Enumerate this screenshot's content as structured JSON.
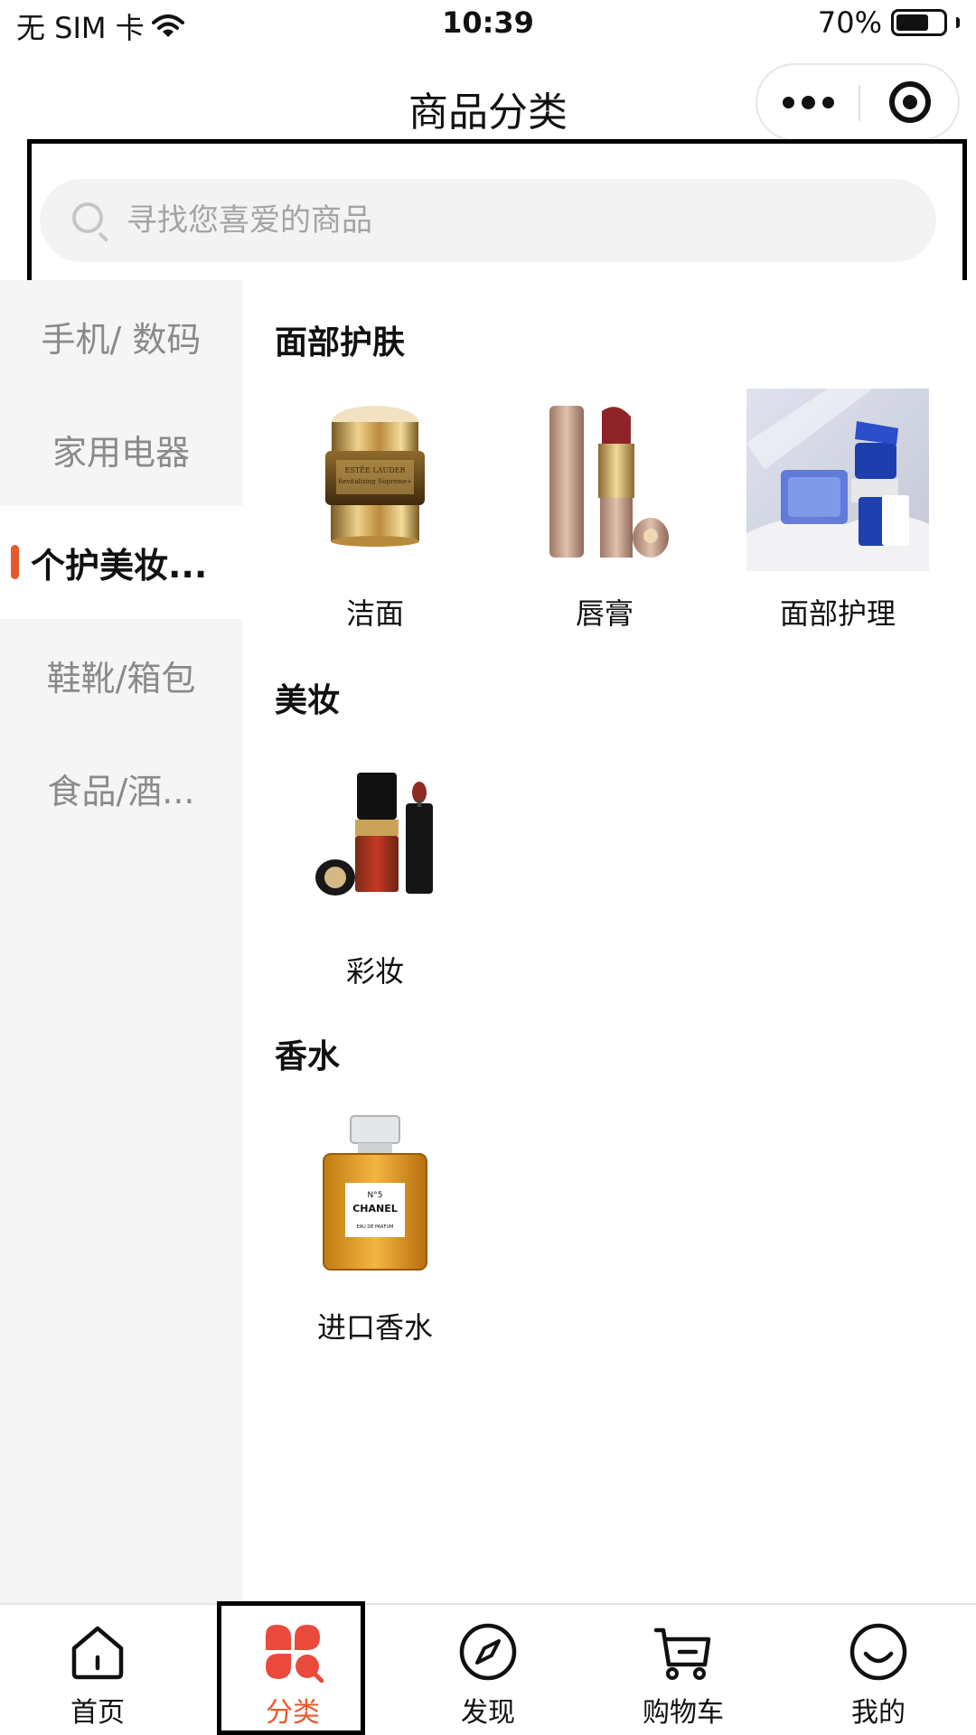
{
  "status_bar": {
    "carrier": "无 SIM 卡",
    "time": "10:39",
    "battery": "70%",
    "battery_level": 0.7
  },
  "nav": {
    "title": "商品分类",
    "more_icon": "more-dots-icon",
    "close_icon": "target-circle-icon"
  },
  "search": {
    "placeholder": "寻找您喜爱的商品",
    "value": ""
  },
  "sidebar": {
    "items": [
      {
        "label": "手机/ 数码",
        "active": false
      },
      {
        "label": "家用电器",
        "active": false
      },
      {
        "label": "个护美妆...",
        "active": true
      },
      {
        "label": "鞋靴/箱包",
        "active": false
      },
      {
        "label": "食品/酒...",
        "active": false
      }
    ],
    "accent": "#e8582a"
  },
  "sections": [
    {
      "title": "面部护肤",
      "items": [
        {
          "label": "洁面",
          "image": "cream-jar"
        },
        {
          "label": "唇膏",
          "image": "lipstick"
        },
        {
          "label": "面部护理",
          "image": "blue-skincare-set"
        }
      ]
    },
    {
      "title": "美妆",
      "items": [
        {
          "label": "彩妆",
          "image": "lip-gloss"
        }
      ]
    },
    {
      "title": "香水",
      "items": [
        {
          "label": "进口香水",
          "image": "perfume-bottle"
        }
      ]
    }
  ],
  "product_art": {
    "cream_brand": "ESTĒE LAUDER",
    "cream_line": "Revitalizing Supreme+",
    "perfume_brand": "CHANEL",
    "perfume_no": "N°5",
    "perfume_type": "EAU DE PARFUM"
  },
  "tabbar": {
    "items": [
      {
        "label": "首页",
        "icon": "home-icon",
        "active": false
      },
      {
        "label": "分类",
        "icon": "category-icon",
        "active": true
      },
      {
        "label": "发现",
        "icon": "compass-icon",
        "active": false
      },
      {
        "label": "购物车",
        "icon": "cart-icon",
        "active": false
      },
      {
        "label": "我的",
        "icon": "profile-smile-icon",
        "active": false
      }
    ],
    "active_color": "#e8582a"
  }
}
